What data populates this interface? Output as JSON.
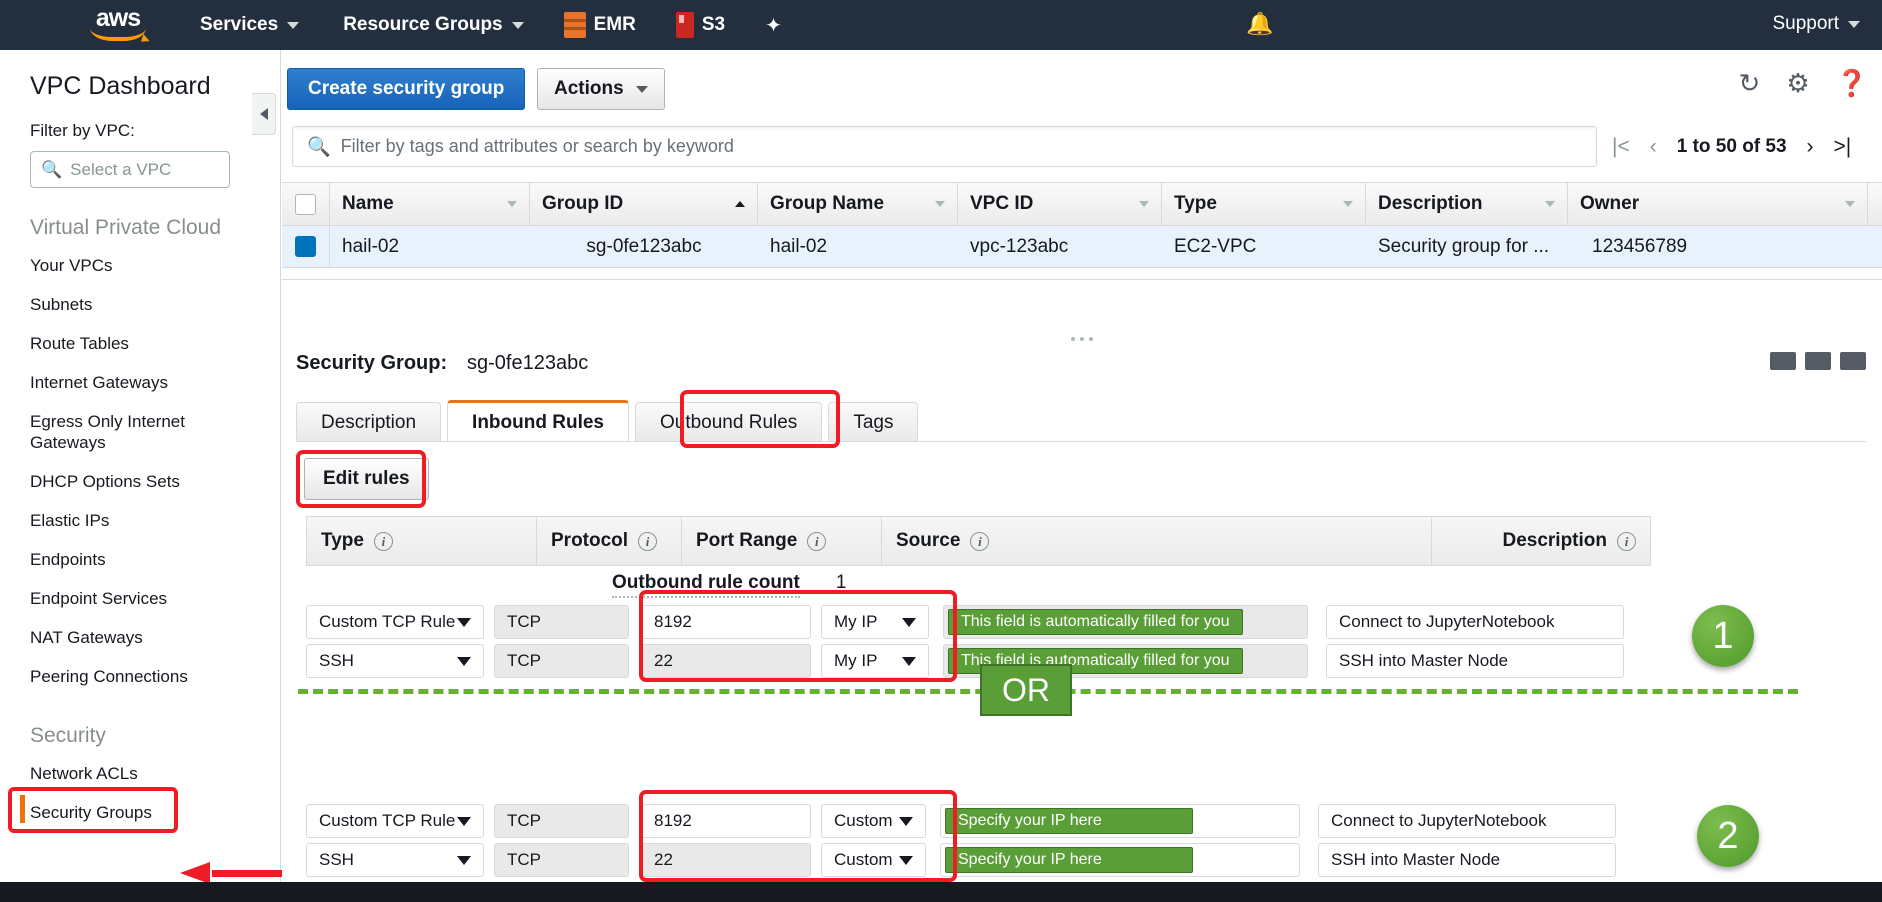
{
  "topnav": {
    "logo_text": "aws",
    "items": [
      {
        "label": "Services",
        "icon": "chevron-down-icon"
      },
      {
        "label": "Resource Groups",
        "icon": "chevron-down-icon"
      }
    ],
    "shortcuts": [
      {
        "label": "EMR",
        "icon": "emr-service-icon"
      },
      {
        "label": "S3",
        "icon": "s3-service-icon"
      }
    ],
    "pin_icon": "pin-icon",
    "bell_icon": "bell-icon",
    "support_label": "Support"
  },
  "sidebar": {
    "title": "VPC Dashboard",
    "filter_label": "Filter by VPC:",
    "vpc_select_placeholder": "Select a VPC",
    "search_icon": "search-icon",
    "sections": [
      {
        "heading": "Virtual Private Cloud",
        "items": [
          "Your VPCs",
          "Subnets",
          "Route Tables",
          "Internet Gateways",
          "Egress Only Internet Gateways",
          "DHCP Options Sets",
          "Elastic IPs",
          "Endpoints",
          "Endpoint Services",
          "NAT Gateways",
          "Peering Connections"
        ]
      },
      {
        "heading": "Security",
        "items": [
          "Network ACLs",
          "Security Groups"
        ]
      }
    ],
    "selected_item": "Security Groups"
  },
  "toolbar": {
    "create_label": "Create security group",
    "actions_label": "Actions",
    "icons": [
      "refresh-icon",
      "gear-icon",
      "help-icon"
    ]
  },
  "filterbar": {
    "placeholder": "Filter by tags and attributes or search by keyword",
    "search_icon": "search-icon",
    "pagination_text": "1 to 50 of 53",
    "first_icon": "|<",
    "prev_icon": "‹",
    "next_icon": "›",
    "last_icon": ">|"
  },
  "table": {
    "columns": [
      "Name",
      "Group ID",
      "Group Name",
      "VPC ID",
      "Type",
      "Description",
      "Owner"
    ],
    "sorted_column": "Group ID",
    "sort_direction": "asc",
    "rows": [
      {
        "selected": true,
        "name": "hail-02",
        "group_id": "sg-0fe123abc",
        "group_name": "hail-02",
        "vpc_id": "vpc-123abc",
        "type": "EC2-VPC",
        "description": "Security group for ...",
        "owner": "123456789"
      }
    ]
  },
  "detail": {
    "sg_label": "Security Group:",
    "sg_value": "sg-0fe123abc",
    "tabs": [
      {
        "label": "Description",
        "active": false
      },
      {
        "label": "Inbound Rules",
        "active": true
      },
      {
        "label": "Outbound Rules",
        "active": false
      },
      {
        "label": "Tags",
        "active": false
      }
    ],
    "edit_rules_label": "Edit rules",
    "rules_columns": [
      "Type",
      "Protocol",
      "Port Range",
      "Source",
      "Description"
    ],
    "outbound_rule_count_label": "Outbound rule count",
    "outbound_rule_count_value": "1"
  },
  "rule_groups": [
    {
      "badge": "1",
      "rows": [
        {
          "type": "Custom TCP Rule",
          "protocol": "TCP",
          "port_range": "8192",
          "source_mode": "My IP",
          "source_note": "This field is automatically filled for you",
          "description": "Connect to JupyterNotebook"
        },
        {
          "type": "SSH",
          "protocol": "TCP",
          "port_range": "22",
          "source_mode": "My IP",
          "source_note": "This field is automatically filled for you",
          "description": "SSH into Master Node"
        }
      ]
    },
    {
      "badge": "2",
      "rows": [
        {
          "type": "Custom TCP Rule",
          "protocol": "TCP",
          "port_range": "8192",
          "source_mode": "Custom",
          "source_note": "Specify your IP here",
          "description": "Connect to JupyterNotebook"
        },
        {
          "type": "SSH",
          "protocol": "TCP",
          "port_range": "22",
          "source_mode": "Custom",
          "source_note": "Specify your IP here",
          "description": "SSH into Master Node"
        }
      ]
    }
  ],
  "annotations": {
    "or_label": "OR",
    "highlight_color": "#ee1c25",
    "accent_green": "#5a9e38",
    "accent_orange": "#ec7211",
    "aws_blue": "#1763b9"
  }
}
